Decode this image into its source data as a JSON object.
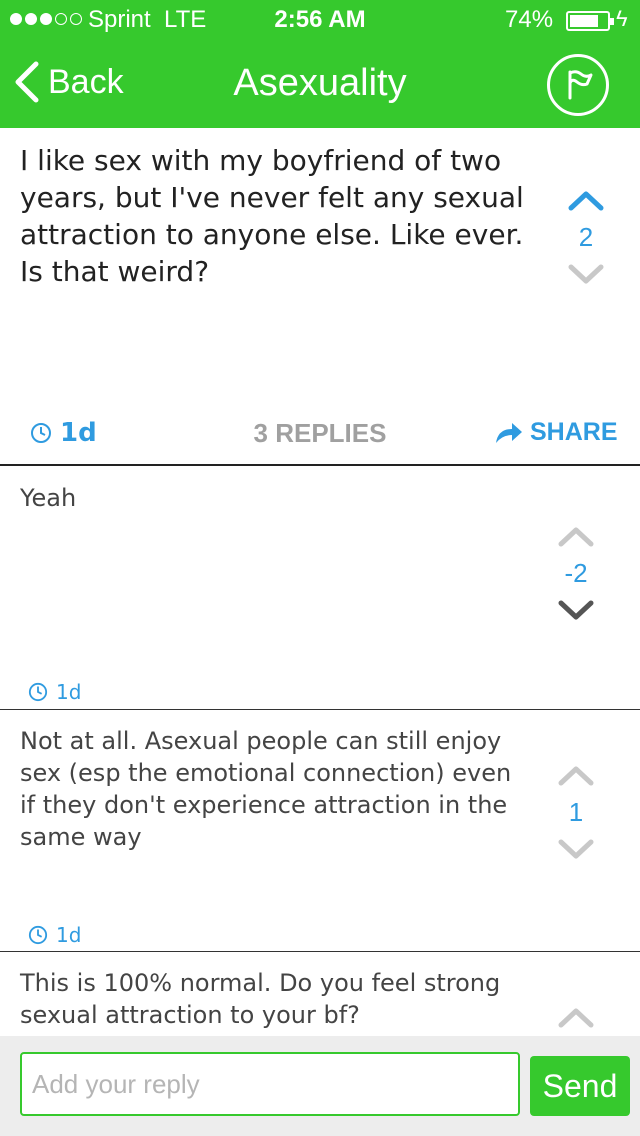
{
  "status_bar": {
    "carrier": "Sprint",
    "network": "LTE",
    "time": "2:56 AM",
    "battery": "74%",
    "battery_level": 0.74,
    "signal_bars": 3,
    "signal_total": 5
  },
  "nav": {
    "back_label": "Back",
    "title": "Asexuality",
    "flag_icon": "flag-icon"
  },
  "post": {
    "text": "I like sex with my boyfriend of two years, but I've never felt any sexual attraction to anyone else. Like ever. Is that weird?",
    "score": "2",
    "time": "1d",
    "replies_label": "3 REPLIES",
    "share_label": "SHARE"
  },
  "replies": [
    {
      "text": "Yeah",
      "score": "-2",
      "time": "1d"
    },
    {
      "text": "Not at all. Asexual people can still enjoy sex (esp the emotional connection) even if they don't experience attraction in the same way",
      "score": "1",
      "time": "1d"
    },
    {
      "text": "This is 100% normal. Do you feel strong sexual attraction to your bf?"
    }
  ],
  "composer": {
    "placeholder": "Add your reply",
    "send_label": "Send"
  },
  "colors": {
    "brand_green": "#36c92d",
    "accent_blue": "#2f9be0",
    "muted_gray": "#a0a0a0"
  }
}
